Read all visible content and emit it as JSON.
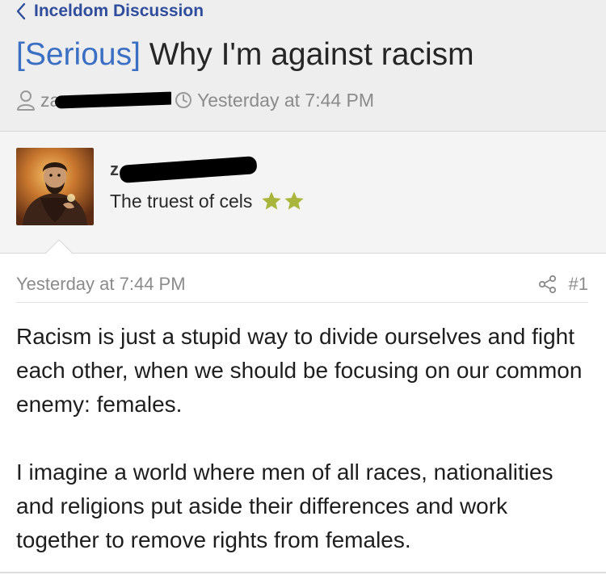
{
  "breadcrumb": {
    "back_label": "Inceldom Discussion"
  },
  "thread": {
    "prefix": "[Serious]",
    "title": "Why I'm against racism",
    "author_visible": "zam",
    "timestamp": "Yesterday at 7:44 PM"
  },
  "poster": {
    "name_visible": "z",
    "user_title": "The truest of cels",
    "star_count": 2,
    "star_color": "#a9b63b"
  },
  "post": {
    "timestamp": "Yesterday at 7:44 PM",
    "number": "#1",
    "paragraphs": [
      "Racism is just a stupid way to divide ourselves and fight each other, when we should be focusing on our common enemy: females.",
      "I imagine a world where men of all races, nationalities and religions put aside their differences and work together to remove rights from females."
    ]
  },
  "icons": {
    "back": "chevron-left-icon",
    "user": "user-icon",
    "clock": "clock-icon",
    "share": "share-icon",
    "star": "star-icon"
  },
  "colors": {
    "link": "#2f4d9c",
    "prefix": "#3a6fc4",
    "header_bg": "#eeeeee",
    "meta_text": "#8b8b8b"
  }
}
